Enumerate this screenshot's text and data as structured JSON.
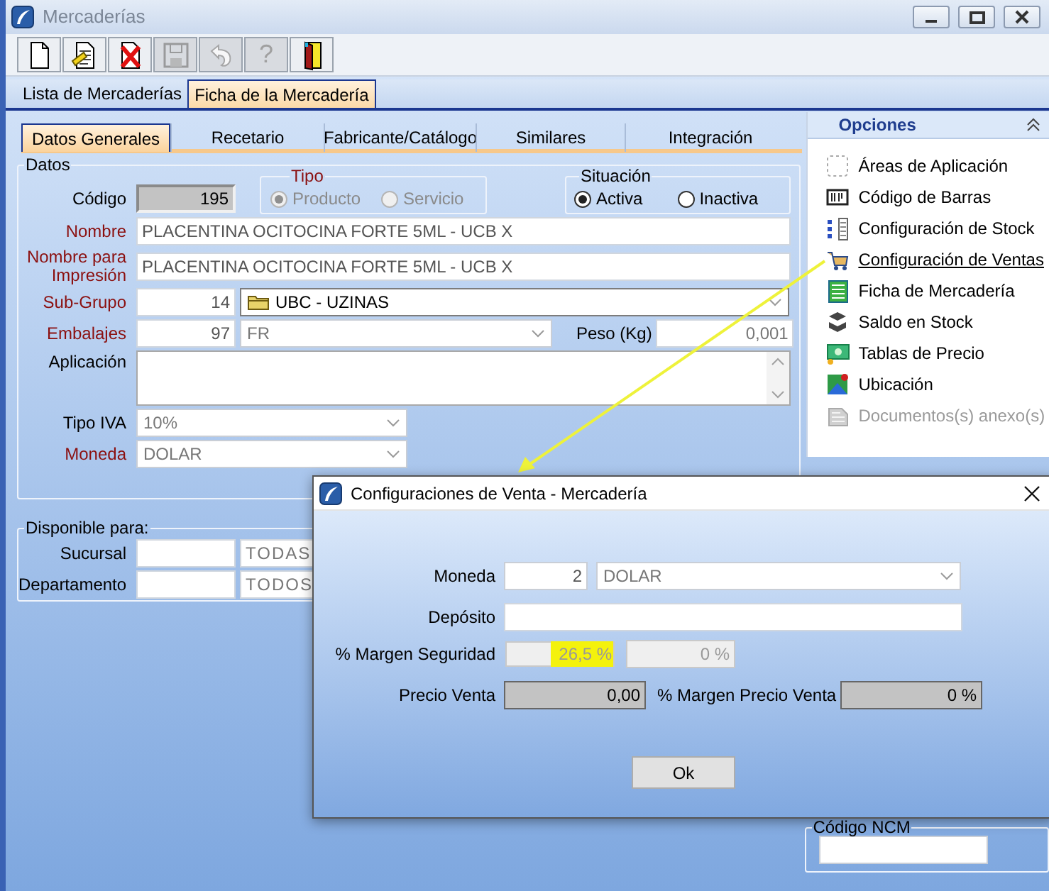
{
  "window": {
    "title": "Mercaderías",
    "active": false
  },
  "toolbar": [
    {
      "kind": "new",
      "disabled": false
    },
    {
      "kind": "edit",
      "disabled": false
    },
    {
      "kind": "delete",
      "disabled": false
    },
    {
      "kind": "save",
      "disabled": true
    },
    {
      "kind": "undo",
      "disabled": true
    },
    {
      "kind": "help",
      "glyph": "?",
      "disabled": true
    },
    {
      "kind": "exit",
      "disabled": false
    }
  ],
  "tabs": [
    {
      "label": "Lista de Mercaderías",
      "selected": false
    },
    {
      "label": "Ficha de la Mercadería",
      "selected": true
    }
  ],
  "subtabs": [
    {
      "label": "Datos Generales",
      "selected": true
    },
    {
      "label": "Recetario",
      "selected": false
    },
    {
      "label": "Fabricante/Catálogo",
      "selected": false
    },
    {
      "label": "Similares",
      "selected": false
    },
    {
      "label": "Integración",
      "selected": false
    }
  ],
  "datos": {
    "title": "Datos",
    "codigo": {
      "label": "Código",
      "value": "195"
    },
    "tipo": {
      "title": "Tipo",
      "options": [
        {
          "label": "Producto",
          "selected": true,
          "disabled": true
        },
        {
          "label": "Servicio",
          "selected": false,
          "disabled": true
        }
      ]
    },
    "situacion": {
      "title": "Situación",
      "options": [
        {
          "label": "Activa",
          "selected": true,
          "disabled": false
        },
        {
          "label": "Inactiva",
          "selected": false,
          "disabled": false
        }
      ]
    },
    "fields": [
      {
        "kind": "text",
        "label": "Nombre",
        "required": true,
        "value": "PLACENTINA OCITOCINA FORTE 5ML - UCB X"
      },
      {
        "kind": "text",
        "label": "Nombre para Impresión",
        "required": true,
        "value": "PLACENTINA OCITOCINA FORTE 5ML - UCB X"
      },
      {
        "kind": "group",
        "label": "Sub-Grupo",
        "required": true,
        "code": "14",
        "value": "UBC - UZINAS"
      },
      {
        "kind": "packing",
        "label": "Embalajes",
        "required": true,
        "code": "97",
        "value": "FR",
        "weight_label": "Peso (Kg)",
        "weight": "0,001"
      },
      {
        "kind": "textarea",
        "label": "Aplicación",
        "required": false
      },
      {
        "kind": "combo",
        "label": "Tipo IVA",
        "required": false,
        "value": "10%"
      },
      {
        "kind": "combo",
        "label": "Moneda",
        "required": true,
        "value": "DOLAR"
      }
    ]
  },
  "disponible": {
    "title": "Disponible para:",
    "rows": [
      {
        "label": "Sucursal",
        "value": "TODAS"
      },
      {
        "label": "Departamento",
        "value": "TODOS"
      }
    ]
  },
  "opciones": {
    "title": "Opciones",
    "items": [
      {
        "kind": "areas",
        "label": "Áreas de Aplicación",
        "disabled": false,
        "hover": false
      },
      {
        "kind": "barcode",
        "label": "Código de Barras",
        "disabled": false,
        "hover": false
      },
      {
        "kind": "stock",
        "label": "Configuración de Stock",
        "disabled": false,
        "hover": false
      },
      {
        "kind": "cart",
        "label": "Configuración de Ventas",
        "disabled": false,
        "hover": true
      },
      {
        "kind": "sheet",
        "label": "Ficha de Mercadería",
        "disabled": false,
        "hover": false
      },
      {
        "kind": "boxes",
        "label": "Saldo en Stock",
        "disabled": false,
        "hover": false
      },
      {
        "kind": "money",
        "label": "Tablas de Precio",
        "disabled": false,
        "hover": false
      },
      {
        "kind": "map",
        "label": "Ubicación",
        "disabled": false,
        "hover": false
      },
      {
        "kind": "docs",
        "label": "Documentos(s) anexo(s)",
        "disabled": true,
        "hover": false
      }
    ]
  },
  "ncm": {
    "title": "Código NCM"
  },
  "dialog": {
    "title": "Configuraciones de Venta - Mercadería",
    "moneda": {
      "label": "Moneda",
      "code": "2",
      "value": "DOLAR"
    },
    "deposito": {
      "label": "Depósito"
    },
    "margen": {
      "label": "% Margen Seguridad",
      "value": "26,5 %",
      "highlighted": true,
      "value2": "0 %"
    },
    "precio": {
      "label": "Precio Venta",
      "value": "0,00"
    },
    "margen_precio": {
      "label": "% Margen Precio Venta",
      "value": "0 %"
    },
    "ok": "Ok"
  }
}
